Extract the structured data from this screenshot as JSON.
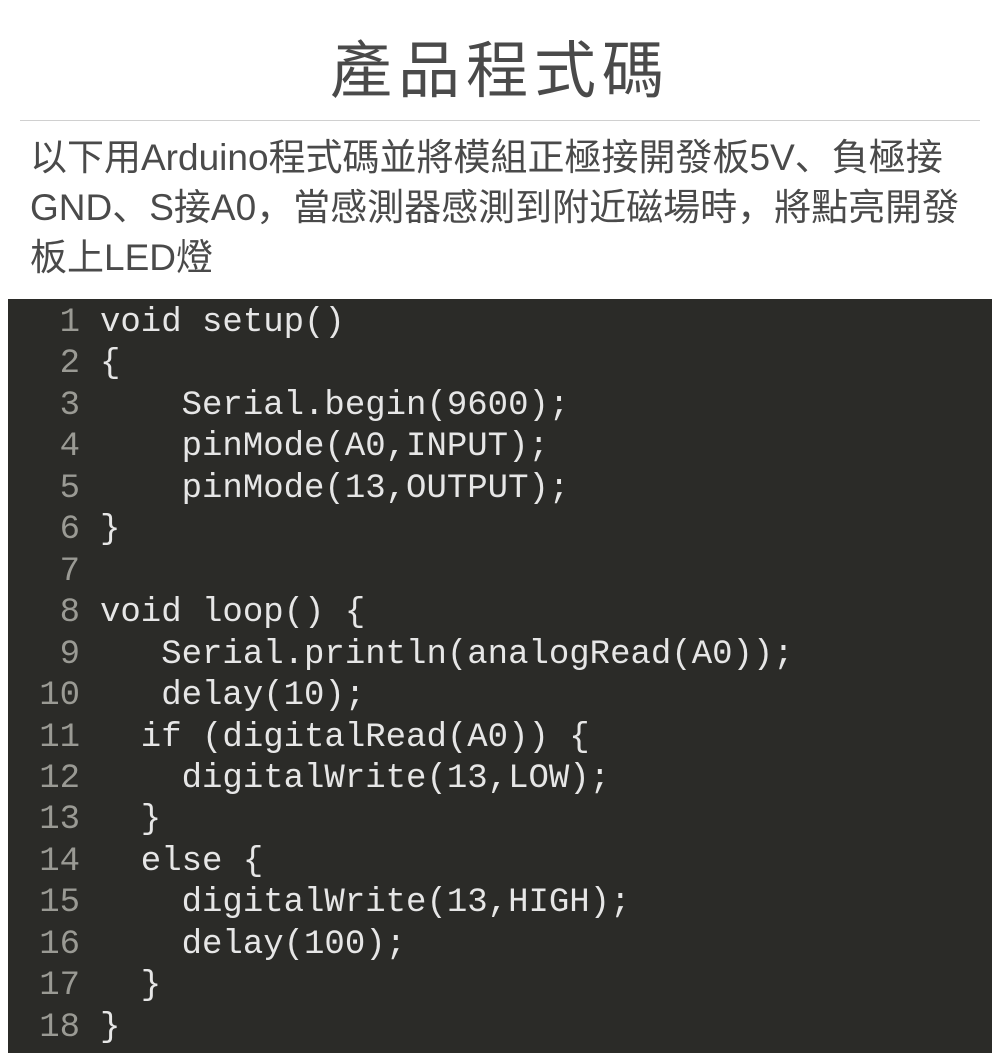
{
  "title": "產品程式碼",
  "description": "以下用Arduino程式碼並將模組正極接開發板5V、負極接GND、S接A0，當感測器感測到附近磁場時，將點亮開發板上LED燈",
  "code": {
    "lines": [
      {
        "n": "1",
        "t": "void setup()"
      },
      {
        "n": "2",
        "t": "{"
      },
      {
        "n": "3",
        "t": "    Serial.begin(9600);"
      },
      {
        "n": "4",
        "t": "    pinMode(A0,INPUT);"
      },
      {
        "n": "5",
        "t": "    pinMode(13,OUTPUT);"
      },
      {
        "n": "6",
        "t": "}"
      },
      {
        "n": "7",
        "t": ""
      },
      {
        "n": "8",
        "t": "void loop() {"
      },
      {
        "n": "9",
        "t": "   Serial.println(analogRead(A0));"
      },
      {
        "n": "10",
        "t": "   delay(10);"
      },
      {
        "n": "11",
        "t": "  if (digitalRead(A0)) {"
      },
      {
        "n": "12",
        "t": "    digitalWrite(13,LOW);"
      },
      {
        "n": "13",
        "t": "  }"
      },
      {
        "n": "14",
        "t": "  else {"
      },
      {
        "n": "15",
        "t": "    digitalWrite(13,HIGH);"
      },
      {
        "n": "16",
        "t": "    delay(100);"
      },
      {
        "n": "17",
        "t": "  }"
      },
      {
        "n": "18",
        "t": "}"
      }
    ]
  }
}
